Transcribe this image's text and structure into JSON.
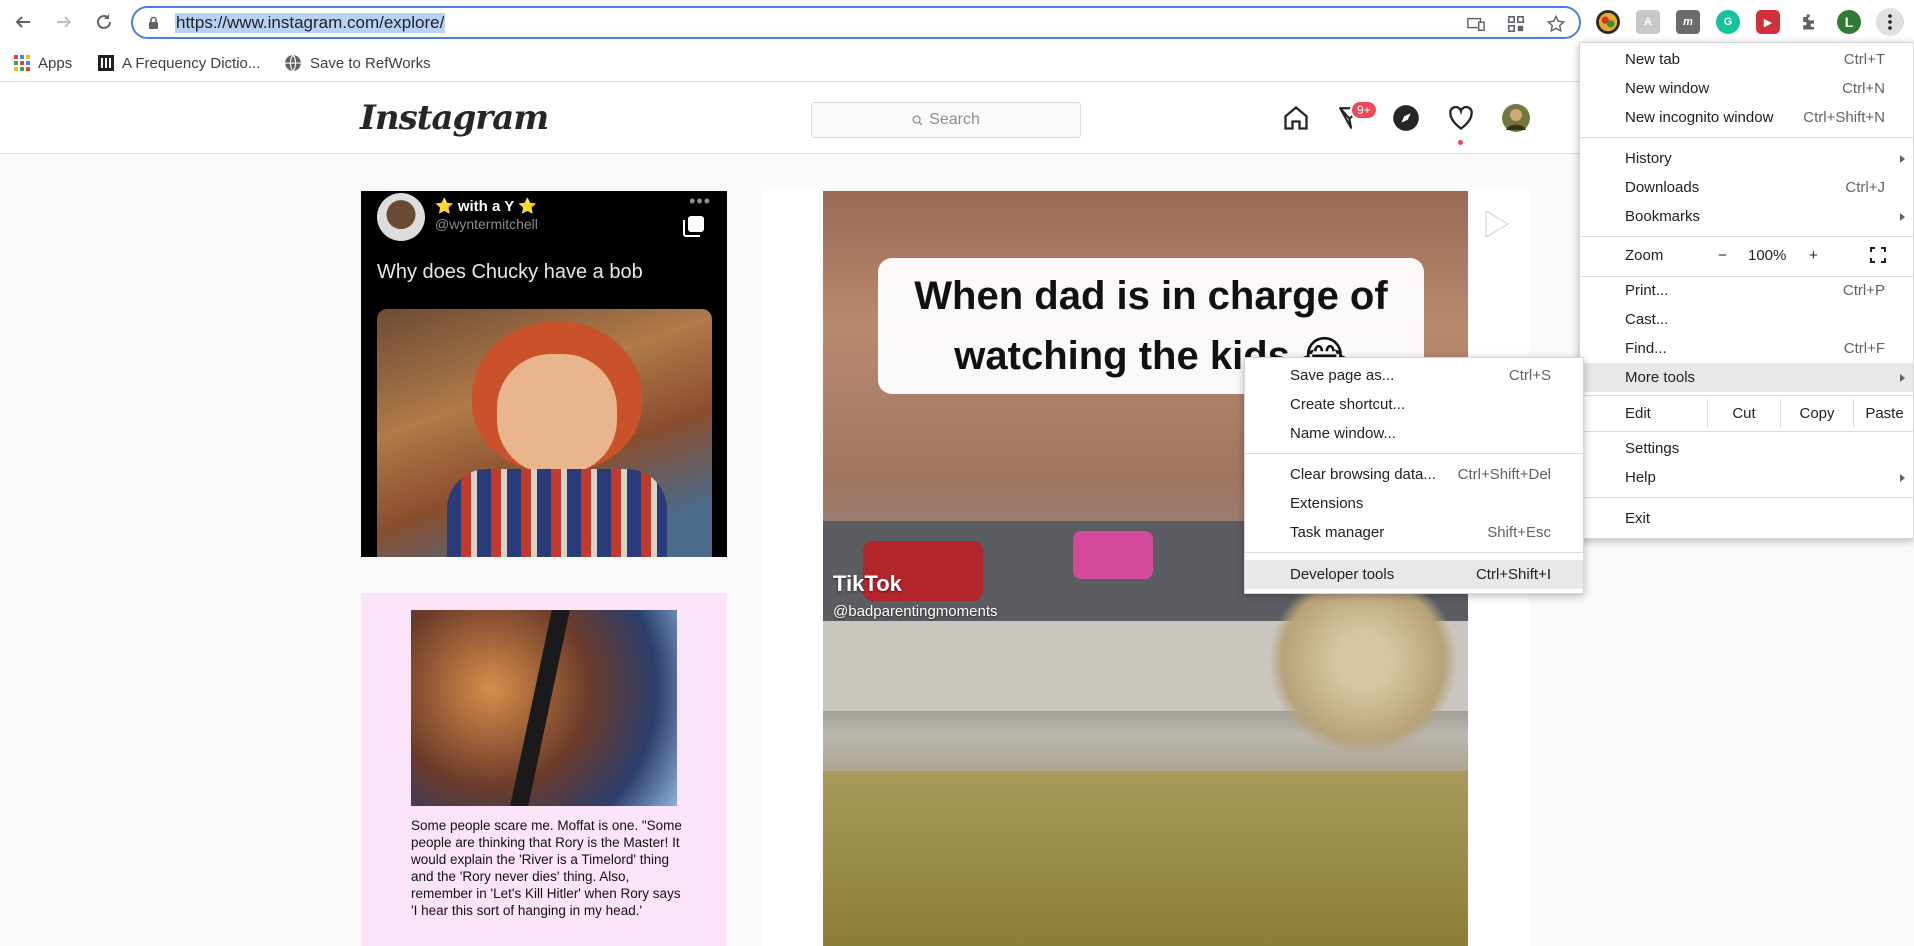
{
  "browser": {
    "url": "https://www.instagram.com/explore/",
    "bookmarks": [
      {
        "label": "Apps",
        "icon": "apps-grid-icon"
      },
      {
        "label": "A Frequency Dictio...",
        "icon": "museum-icon"
      },
      {
        "label": "Save to RefWorks",
        "icon": "globe-icon"
      }
    ],
    "profile_initial": "L"
  },
  "instagram": {
    "logo": "Instagram",
    "search_placeholder": "Search",
    "direct_badge": "9+",
    "posts": {
      "tweet": {
        "name": "⭐ with a Y ⭐",
        "handle": "@wyntermitchell",
        "text": "Why does Chucky have a bob"
      },
      "meme_text": "Some people scare me. Moffat is one. \"Some people are thinking that Rory is the Master! It would explain the 'River is a Timelord' thing and the 'Rory never dies' thing. Also, remember in 'Let's Kill Hitler' when Rory says 'I hear this sort of hanging in my head.'",
      "video": {
        "caption": "When dad is in charge of watching the kids 😂",
        "tiktok": "TikTok",
        "tiktok_handle": "@badparentingmoments"
      }
    }
  },
  "chrome_menu": {
    "new_tab": "New tab",
    "new_tab_sc": "Ctrl+T",
    "new_window": "New window",
    "new_window_sc": "Ctrl+N",
    "incognito": "New incognito window",
    "incognito_sc": "Ctrl+Shift+N",
    "history": "History",
    "downloads": "Downloads",
    "downloads_sc": "Ctrl+J",
    "bookmarks": "Bookmarks",
    "zoom": "Zoom",
    "zoom_minus": "−",
    "zoom_value": "100%",
    "zoom_plus": "+",
    "print": "Print...",
    "print_sc": "Ctrl+P",
    "cast": "Cast...",
    "find": "Find...",
    "find_sc": "Ctrl+F",
    "more_tools": "More tools",
    "edit": "Edit",
    "cut": "Cut",
    "copy": "Copy",
    "paste": "Paste",
    "settings": "Settings",
    "help": "Help",
    "exit": "Exit"
  },
  "more_tools_menu": {
    "save_page": "Save page as...",
    "save_page_sc": "Ctrl+S",
    "create_shortcut": "Create shortcut...",
    "name_window": "Name window...",
    "clear_data": "Clear browsing data...",
    "clear_data_sc": "Ctrl+Shift+Del",
    "extensions": "Extensions",
    "task_manager": "Task manager",
    "task_manager_sc": "Shift+Esc",
    "dev_tools": "Developer tools",
    "dev_tools_sc": "Ctrl+Shift+I"
  }
}
